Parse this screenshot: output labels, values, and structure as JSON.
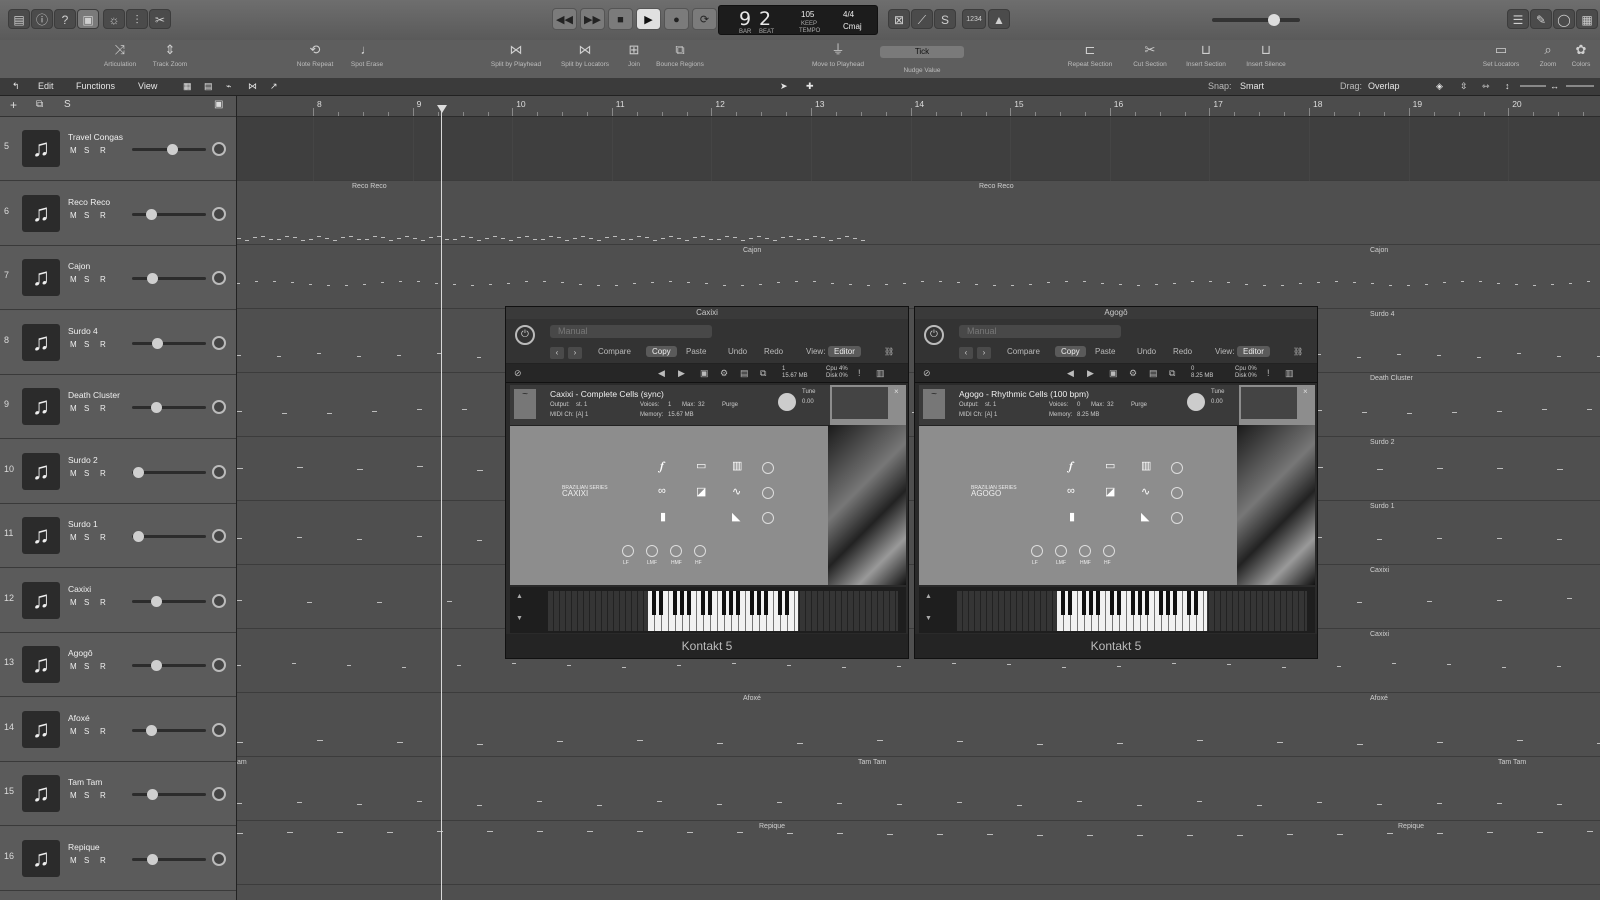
{
  "lcd": {
    "bar": "9",
    "beat": "2",
    "bar_lbl": "BAR",
    "beat_lbl": "BEAT",
    "tempo": "105",
    "tempo_lbl": "KEEP",
    "tempo_sub": "TEMPO",
    "signature": "4/4",
    "key": "Cmaj"
  },
  "control": {
    "count_in": "1234"
  },
  "toolbar": [
    {
      "label": "Articulation"
    },
    {
      "label": "Track Zoom"
    },
    {
      "label": "Note Repeat"
    },
    {
      "label": "Spot Erase"
    },
    {
      "label": "Split by Playhead"
    },
    {
      "label": "Split by Locators"
    },
    {
      "label": "Join"
    },
    {
      "label": "Bounce Regions"
    },
    {
      "label": "Move to Playhead"
    },
    {
      "label": "Nudge Value"
    },
    {
      "label": "Repeat Section"
    },
    {
      "label": "Cut Section"
    },
    {
      "label": "Insert Section"
    },
    {
      "label": "Insert Silence"
    },
    {
      "label": "Set Locators"
    },
    {
      "label": "Zoom"
    },
    {
      "label": "Colors"
    }
  ],
  "nudge_value": "Tick",
  "menu": {
    "edit": "Edit",
    "functions": "Functions",
    "view": "View",
    "snap_lbl": "Snap:",
    "snap_val": "Smart",
    "drag_lbl": "Drag:",
    "drag_val": "Overlap"
  },
  "ruler": [
    "8",
    "9",
    "10",
    "11",
    "12",
    "13",
    "14",
    "15",
    "16",
    "17",
    "18",
    "19",
    "20"
  ],
  "tracks": [
    {
      "num": "5",
      "name": "Travel Congas",
      "fader": 0.55
    },
    {
      "num": "6",
      "name": "Reco Reco",
      "fader": 0.22
    },
    {
      "num": "7",
      "name": "Cajon",
      "fader": 0.24
    },
    {
      "num": "8",
      "name": "Surdo 4",
      "fader": 0.32
    },
    {
      "num": "9",
      "name": "Death Cluster",
      "fader": 0.3
    },
    {
      "num": "10",
      "name": "Surdo 2",
      "fader": 0.02
    },
    {
      "num": "11",
      "name": "Surdo 1",
      "fader": 0.02
    },
    {
      "num": "12",
      "name": "Caxixi",
      "fader": 0.3
    },
    {
      "num": "13",
      "name": "Agogô",
      "fader": 0.3
    },
    {
      "num": "14",
      "name": "Afoxé",
      "fader": 0.22
    },
    {
      "num": "15",
      "name": "Tam Tam",
      "fader": 0.24
    },
    {
      "num": "16",
      "name": "Repique",
      "fader": 0.24
    }
  ],
  "regions": {
    "reco1": "Reco Reco",
    "reco2": "Reco Reco",
    "cajon1": "Cajon",
    "cajon2": "Cajon",
    "surdo4": "Surdo 4",
    "death": "Death Cluster",
    "surdo2": "Surdo 2",
    "surdo1": "Surdo 1",
    "caxixi": "Caxixi",
    "caxixi2": "Caxixi",
    "afoxe1": "Afoxé",
    "afoxe2": "Afoxé",
    "tam1": "Tam Tam",
    "tam2": "Tam Tam",
    "tam3": "am",
    "rep1": "Repique",
    "rep2": "Repique"
  },
  "plugins": [
    {
      "title": "Caxixi",
      "preset": "Manual",
      "compare": "Compare",
      "copy": "Copy",
      "paste": "Paste",
      "undo": "Undo",
      "redo": "Redo",
      "view_lbl": "View:",
      "view_val": "Editor",
      "inst": "Caxixi - Complete Cells (sync)",
      "memory": "15.67 MB",
      "voices": "1",
      "max": "32",
      "purge": "Purge",
      "tune": "Tune",
      "tune_val": "0.00",
      "output": "st. 1",
      "midi": "[A] 1",
      "footer": "Kontakt 5",
      "brand1": "BRAZILIAN SERIES",
      "brand2": "CAXIXI",
      "cpu": "4%",
      "disk": "0%",
      "mem2": "15.67 MB"
    },
    {
      "title": "Agogô",
      "preset": "Manual",
      "compare": "Compare",
      "copy": "Copy",
      "paste": "Paste",
      "undo": "Undo",
      "redo": "Redo",
      "view_lbl": "View:",
      "view_val": "Editor",
      "inst": "Agogo - Rhythmic Cells (100 bpm)",
      "memory": "8.25 MB",
      "voices": "0",
      "max": "32",
      "purge": "Purge",
      "tune": "Tune",
      "tune_val": "0.00",
      "output": "st. 1",
      "midi": "[A] 1",
      "footer": "Kontakt 5",
      "brand1": "BRAZILIAN SERIES",
      "brand2": "AGOGO",
      "cpu": "0%",
      "disk": "0%",
      "mem2": "8.25 MB"
    }
  ],
  "eq": [
    "LF",
    "LMF",
    "HMF",
    "HF"
  ],
  "labels": {
    "output": "Output:",
    "midi": "MIDI Ch:",
    "voices": "Voices:",
    "max": "Max:",
    "memory": "Memory:",
    "cpu": "Cpu",
    "disk": "Disk"
  }
}
